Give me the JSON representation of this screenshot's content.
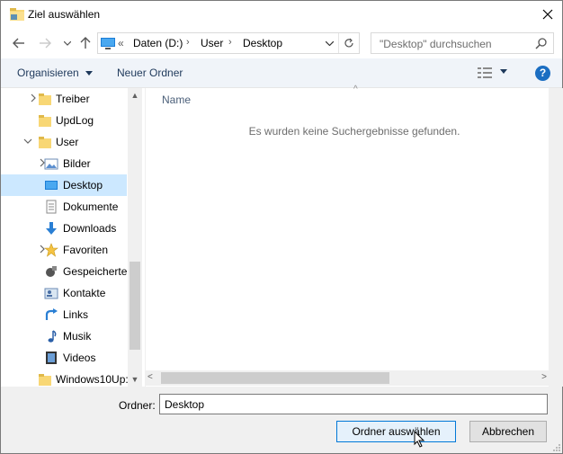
{
  "window": {
    "title": "Ziel auswählen",
    "title_icon": "folder-icon",
    "close_icon": "close-icon"
  },
  "nav": {
    "back_icon": "back-arrow-icon",
    "forward_icon": "forward-arrow-icon",
    "recent_icon": "chevron-down-icon",
    "up_icon": "up-arrow-icon",
    "address": {
      "overflow": "«",
      "segments": [
        "Daten (D:)",
        "User",
        "Desktop"
      ],
      "separator": "›"
    },
    "search_placeholder": "\"Desktop\" durchsuchen"
  },
  "toolbar": {
    "organize_label": "Organisieren",
    "new_folder_label": "Neuer Ordner",
    "help_label": "?"
  },
  "tree": {
    "items": [
      {
        "label": "Treiber",
        "icon": "folder-icon",
        "expander": "collapsed"
      },
      {
        "label": "UpdLog",
        "icon": "folder-icon",
        "expander": "none"
      },
      {
        "label": "User",
        "icon": "folder-icon",
        "expander": "expanded"
      },
      {
        "label": "Bilder",
        "icon": "pictures-icon",
        "expander": "collapsed"
      },
      {
        "label": "Desktop",
        "icon": "desktop-icon",
        "expander": "none",
        "selected": true
      },
      {
        "label": "Dokumente",
        "icon": "documents-icon",
        "expander": "none"
      },
      {
        "label": "Downloads",
        "icon": "downloads-icon",
        "expander": "none"
      },
      {
        "label": "Favoriten",
        "icon": "star-icon",
        "expander": "collapsed"
      },
      {
        "label": "Gespeicherte",
        "icon": "saved-games-icon",
        "expander": "none"
      },
      {
        "label": "Kontakte",
        "icon": "contacts-icon",
        "expander": "none"
      },
      {
        "label": "Links",
        "icon": "links-icon",
        "expander": "none"
      },
      {
        "label": "Musik",
        "icon": "music-icon",
        "expander": "none"
      },
      {
        "label": "Videos",
        "icon": "videos-icon",
        "expander": "none"
      },
      {
        "label": "Windows10Up:",
        "icon": "folder-icon",
        "expander": "none"
      }
    ]
  },
  "filelist": {
    "column_name": "Name",
    "empty_message": "Es wurden keine Suchergebnisse gefunden."
  },
  "bottom": {
    "folder_label": "Ordner:",
    "folder_value": "Desktop",
    "select_button": "Ordner auswählen",
    "cancel_button": "Abbrechen"
  },
  "colors": {
    "selection": "#cce8ff",
    "folder_yellow": "#f8d775",
    "accent": "#0078d7"
  }
}
